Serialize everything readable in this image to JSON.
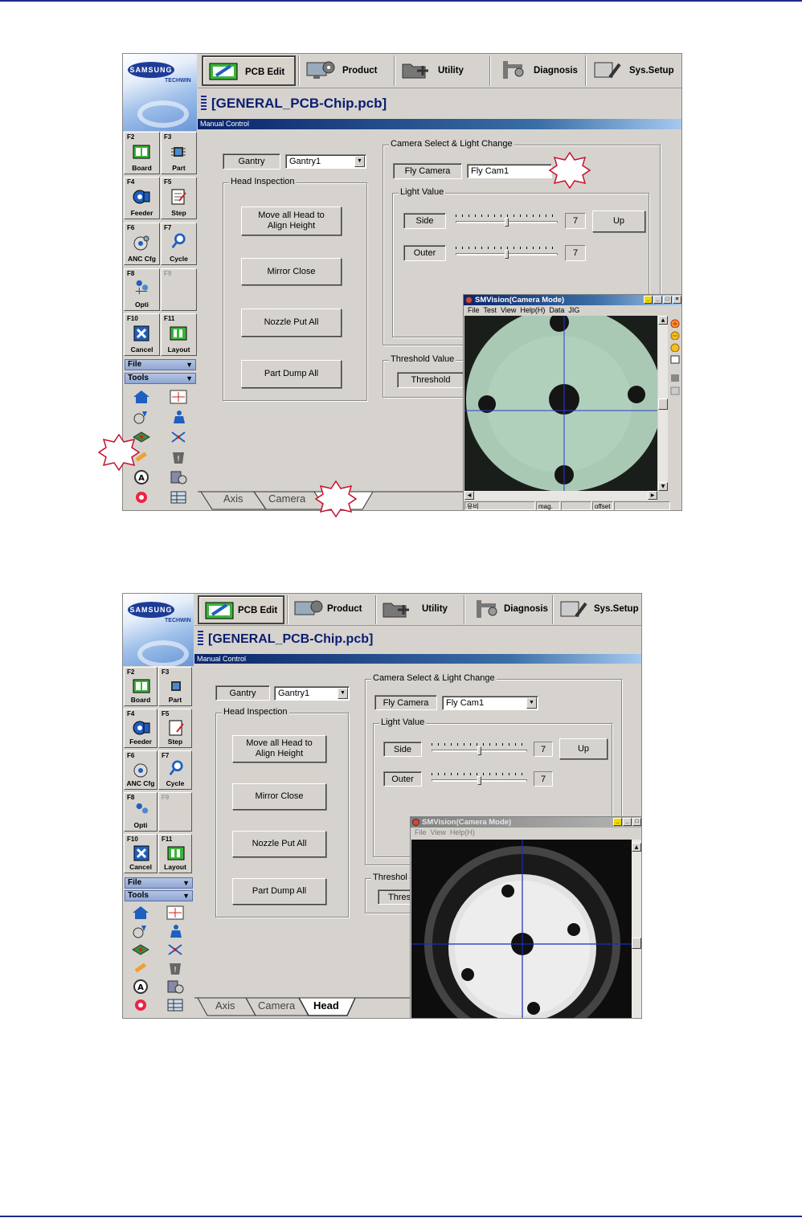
{
  "toolbar": {
    "pcb_edit": "PCB Edit",
    "product": "Product",
    "utility": "Utility",
    "diagnosis": "Diagnosis",
    "sys_setup": "Sys.Setup"
  },
  "logo": {
    "brand": "SAMSUNG",
    "sub": "TECHWIN"
  },
  "file_title": "[GENERAL_PCB-Chip.pcb]",
  "panel_title": "Manual Control",
  "fkeys": [
    {
      "fn": "F2",
      "label": "Board"
    },
    {
      "fn": "F3",
      "label": "Part"
    },
    {
      "fn": "F4",
      "label": "Feeder"
    },
    {
      "fn": "F5",
      "label": "Step"
    },
    {
      "fn": "F6",
      "label": "ANC Cfg"
    },
    {
      "fn": "F7",
      "label": "Cycle"
    },
    {
      "fn": "F8",
      "label": "Opti"
    },
    {
      "fn": "F9",
      "label": ""
    },
    {
      "fn": "F10",
      "label": "Cancel"
    },
    {
      "fn": "F11",
      "label": "Layout"
    }
  ],
  "side_menu": {
    "file": "File",
    "tools": "Tools"
  },
  "gantry": {
    "label": "Gantry",
    "value": "Gantry1"
  },
  "head_inspection": {
    "caption": "Head Inspection",
    "move_all": "Move all Head to\nAlign Height",
    "mirror_close": "Mirror Close",
    "nozzle_put_all": "Nozzle Put All",
    "part_dump_all": "Part Dump All"
  },
  "camera": {
    "caption": "Camera Select & Light Change",
    "fly_camera_label": "Fly Camera",
    "fly_camera_value": "Fly Cam1",
    "light_caption": "Light Value",
    "side_label": "Side",
    "side_value": "7",
    "side_level": 0.5,
    "up_label": "Up",
    "outer_label": "Outer",
    "outer_value": "7",
    "outer_level": 0.5
  },
  "threshold": {
    "caption1": "Threshold Value",
    "button1": "Threshold",
    "caption2": "Threshol",
    "button2": "Thres"
  },
  "tabs": {
    "axis": "Axis",
    "camera": "Camera",
    "head": "Head"
  },
  "vision1": {
    "title": "SMVision(Camera Mode)",
    "menu": [
      "File",
      "Test",
      "View",
      "Help(H)",
      "Data",
      "JIG"
    ],
    "status": [
      "유비",
      "mag.",
      "offset"
    ]
  },
  "vision2": {
    "title": "SMVision(Camera Mode)",
    "menu": [
      "File",
      "View",
      "Help(H)"
    ]
  },
  "colors": {
    "accent": "#0a246a",
    "title_text": "#0b1d6f",
    "rule": "#1b2a8c",
    "window_bg": "#d6d3ce",
    "callout": "#c8102e"
  }
}
